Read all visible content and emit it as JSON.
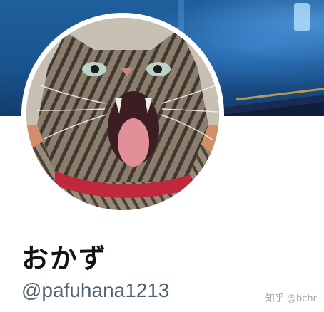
{
  "profile": {
    "display_name": "おかず",
    "handle": "@pafuhana1213"
  },
  "watermark": "知乎 @bchr",
  "icons": {
    "avatar": "cat-avatar-icon",
    "banner": "profile-banner"
  },
  "colors": {
    "name": "#0f1419",
    "handle": "#536471",
    "banner": "#1a5590"
  }
}
